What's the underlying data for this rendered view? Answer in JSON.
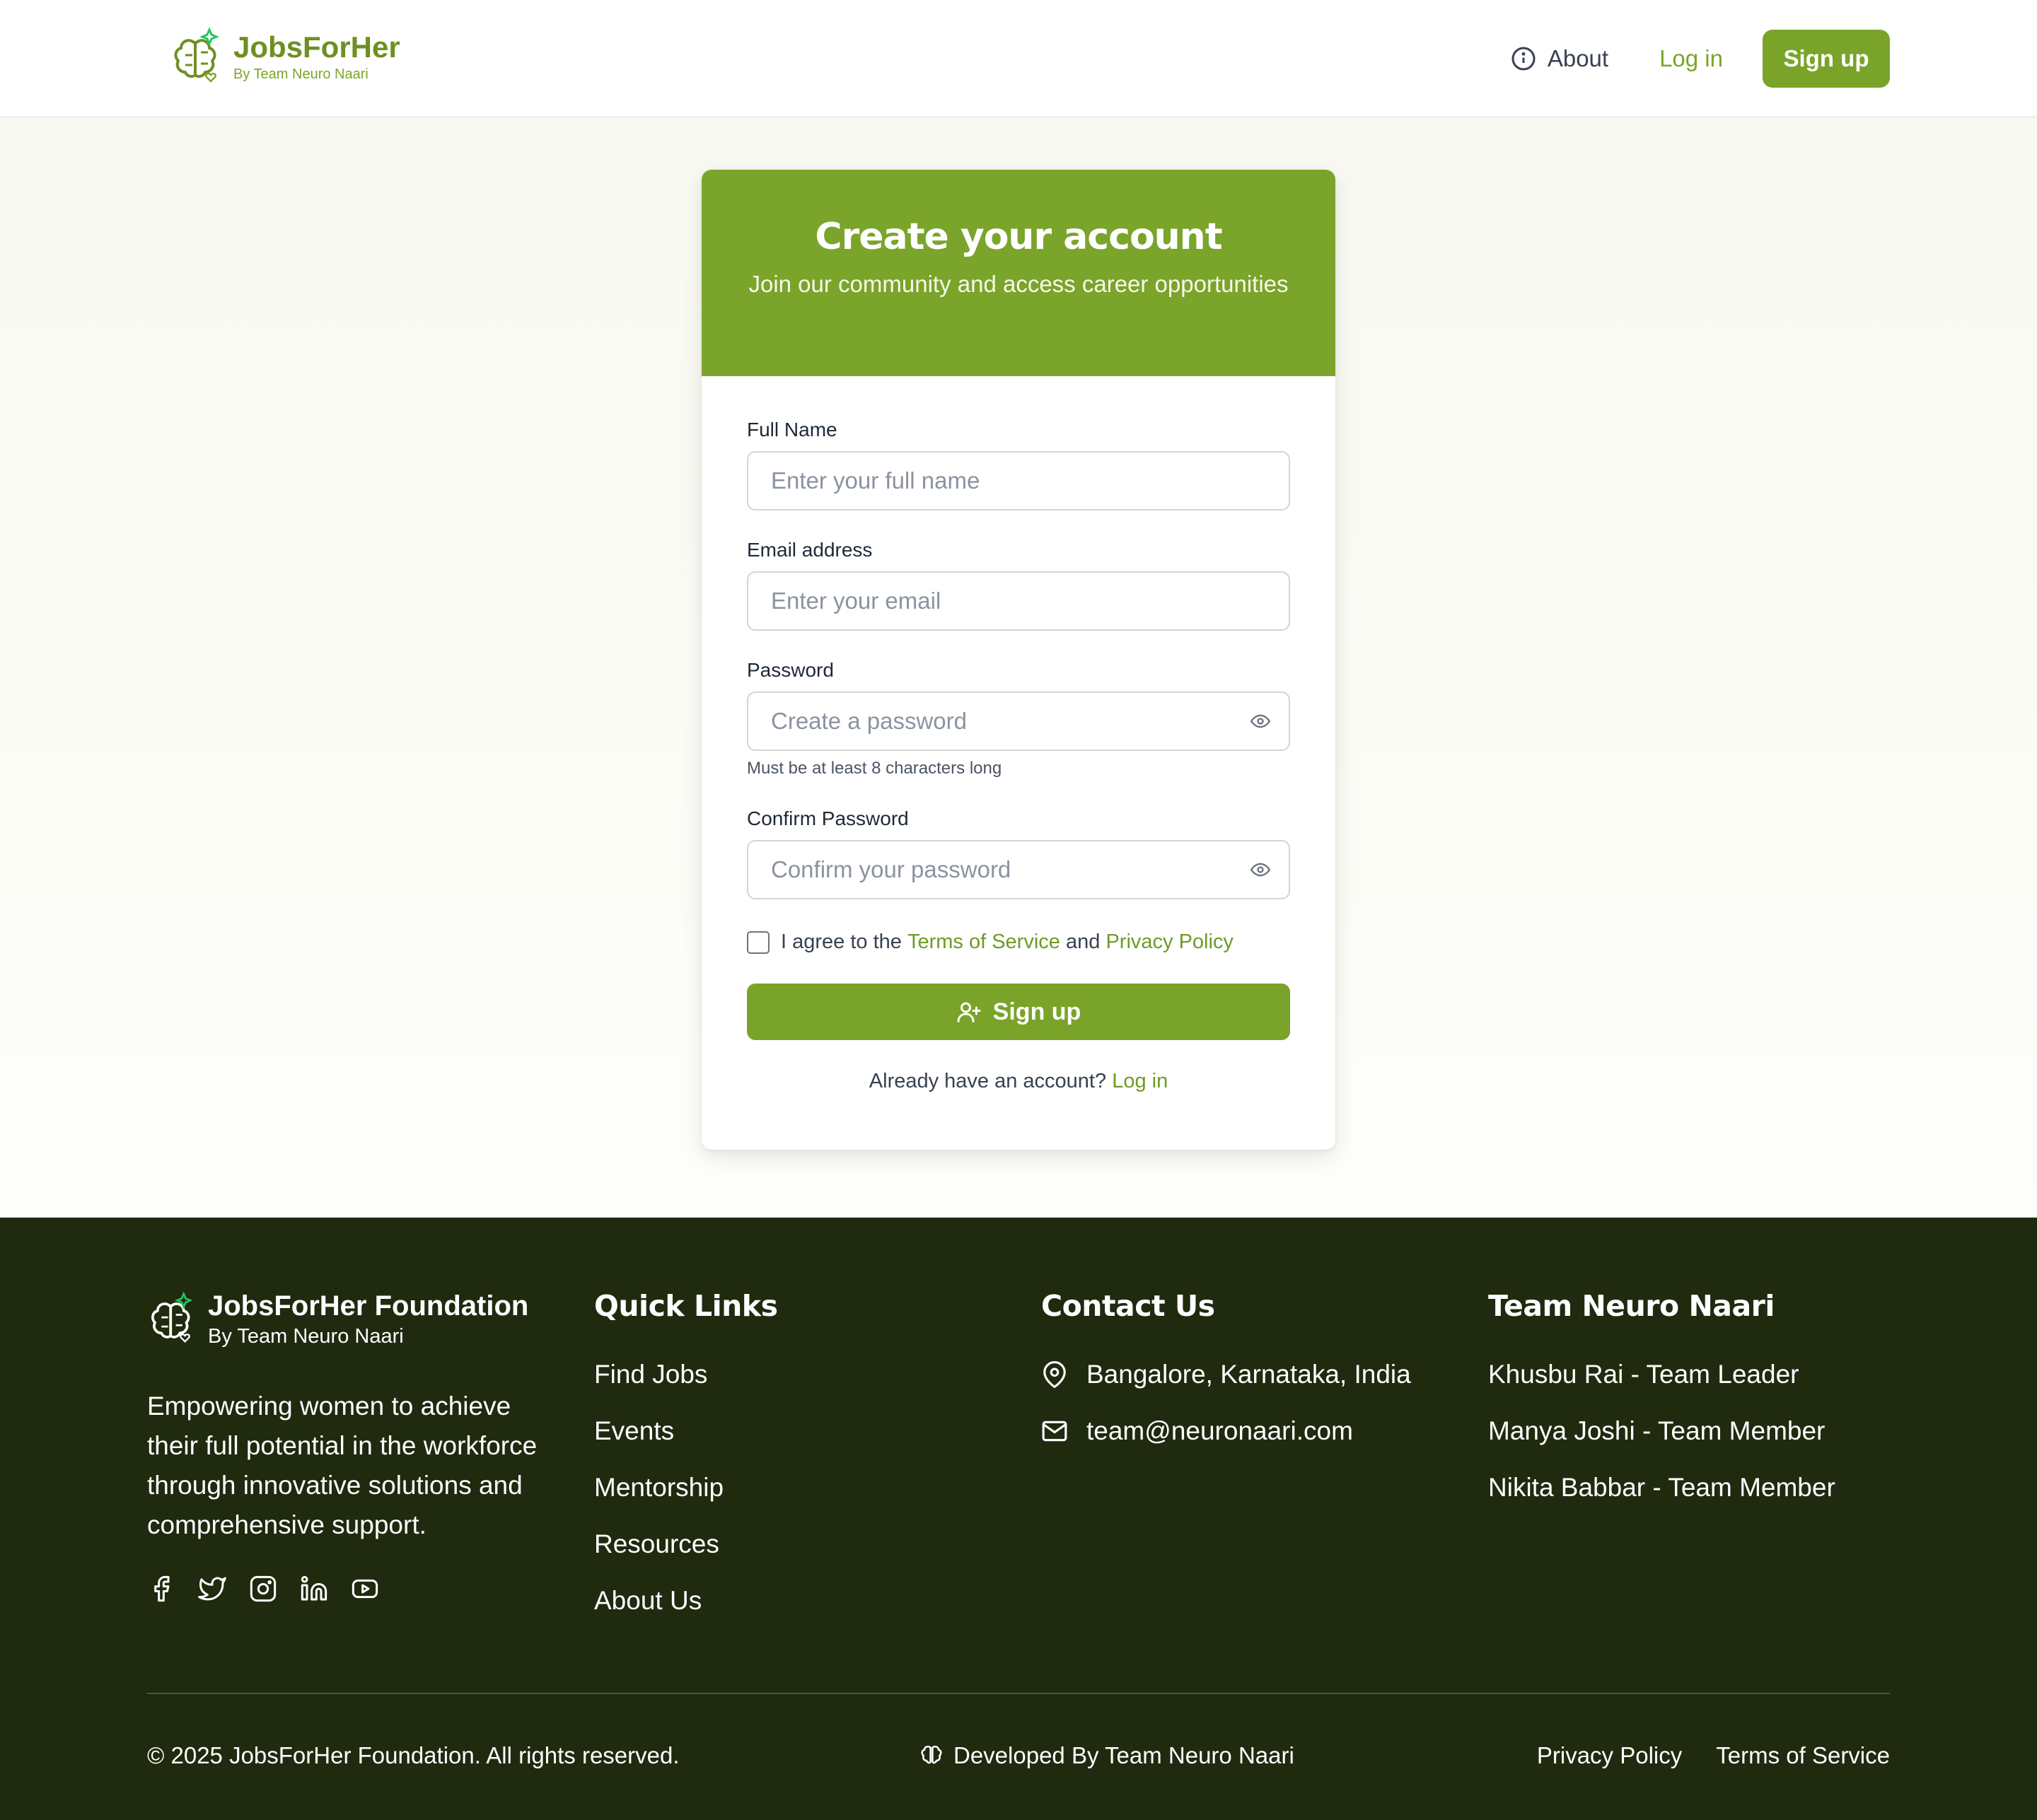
{
  "header": {
    "brand_name": "JobsForHer",
    "brand_sub": "By Team Neuro Naari",
    "nav_about": "About",
    "nav_login": "Log in",
    "nav_signup": "Sign up"
  },
  "card": {
    "title": "Create your account",
    "subtitle": "Join our community and access career opportunities",
    "full_name_label": "Full Name",
    "full_name_placeholder": "Enter your full name",
    "email_label": "Email address",
    "email_placeholder": "Enter your email",
    "password_label": "Password",
    "password_placeholder": "Create a password",
    "password_hint": "Must be at least 8 characters long",
    "confirm_label": "Confirm Password",
    "confirm_placeholder": "Confirm your password",
    "agree_prefix": "I agree to the",
    "agree_terms": "Terms of Service",
    "agree_and": "and",
    "agree_privacy": "Privacy Policy",
    "submit_label": "Sign up",
    "already_text": "Already have an account?",
    "already_login": "Log in"
  },
  "footer": {
    "brand_name": "JobsForHer Foundation",
    "brand_sub": "By Team Neuro Naari",
    "description": "Empowering women to achieve their full potential in the workforce through innovative solutions and comprehensive support.",
    "quick_links_title": "Quick Links",
    "quick_links": [
      "Find Jobs",
      "Events",
      "Mentorship",
      "Resources",
      "About Us"
    ],
    "contact_title": "Contact Us",
    "contact_location": "Bangalore, Karnataka, India",
    "contact_email": "team@neuronaari.com",
    "team_title": "Team Neuro Naari",
    "team": [
      "Khusbu Rai - Team Leader",
      "Manya Joshi - Team Member",
      "Nikita Babbar - Team Member"
    ],
    "copyright": "© 2025 JobsForHer Foundation. All rights reserved.",
    "developed_by": "Developed By Team Neuro Naari",
    "privacy": "Privacy Policy",
    "terms": "Terms of Service",
    "socials": [
      "facebook-icon",
      "twitter-icon",
      "instagram-icon",
      "linkedin-icon",
      "youtube-icon"
    ]
  },
  "colors": {
    "accent": "#7aa32a",
    "footer_bg": "#1f2a0f"
  }
}
